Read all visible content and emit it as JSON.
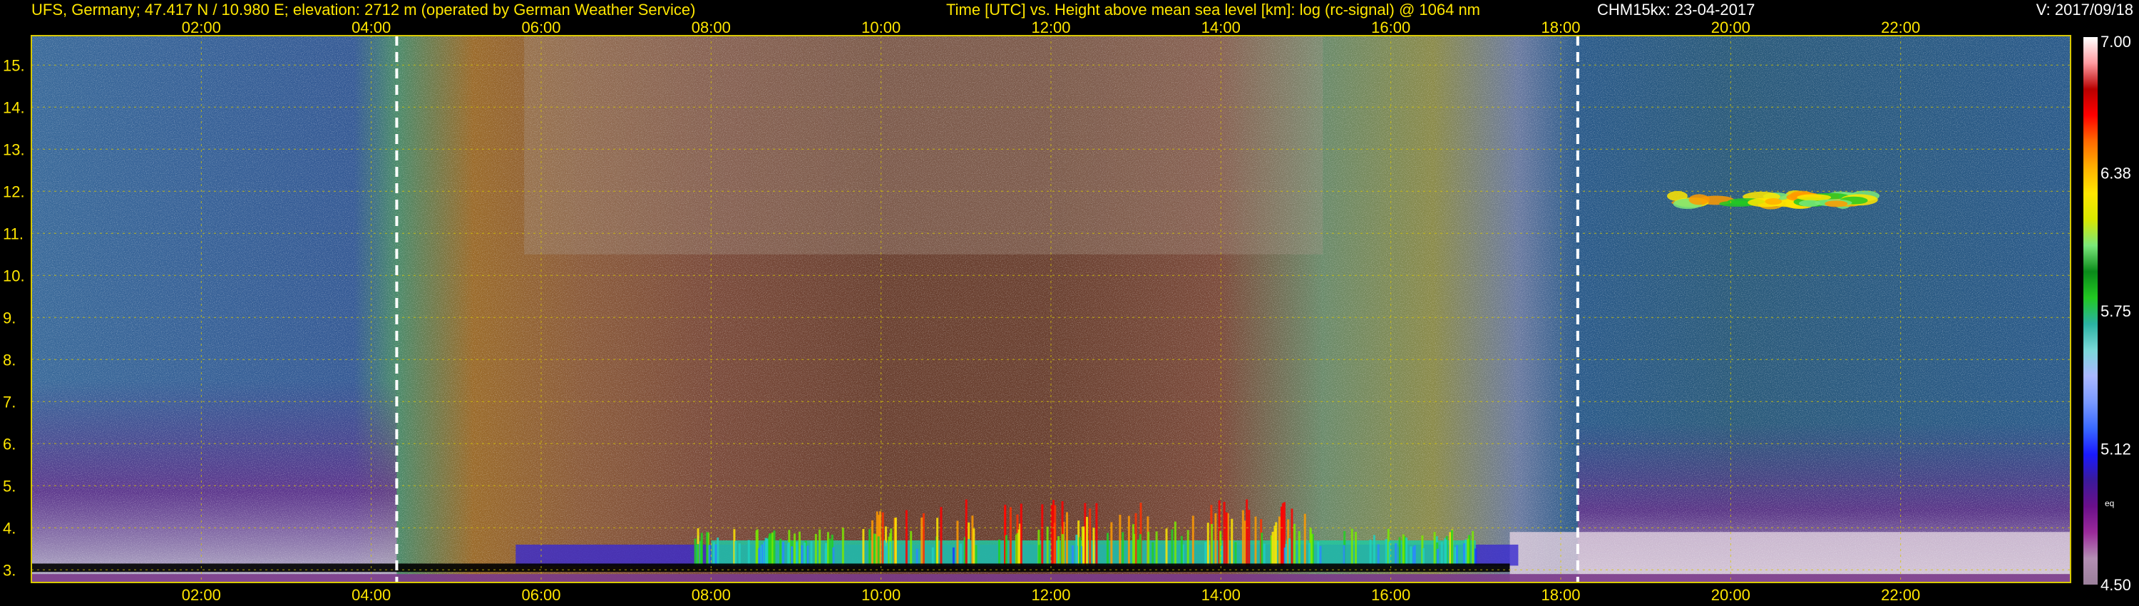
{
  "header": {
    "left": "UFS, Germany; 47.417 N / 10.980 E; elevation: 2712 m  (operated by German Weather Service)",
    "center": "Time [UTC] vs. Height above mean sea level [km]: log (rc-signal) @ 1064 nm",
    "instrument": "CHM15kx: 23-04-2017",
    "version": "V: 2017/09/18"
  },
  "chart_data": {
    "type": "heatmap",
    "xlabel": "Time [UTC]",
    "ylabel": "Height above mean sea level [km]",
    "x_range_hours": [
      0,
      24
    ],
    "y_range_km": [
      2.7,
      15.7
    ],
    "x_ticks": [
      {
        "hour": 2,
        "label": "02:00"
      },
      {
        "hour": 4,
        "label": "04:00"
      },
      {
        "hour": 6,
        "label": "06:00"
      },
      {
        "hour": 8,
        "label": "08:00"
      },
      {
        "hour": 10,
        "label": "10:00"
      },
      {
        "hour": 12,
        "label": "12:00"
      },
      {
        "hour": 14,
        "label": "14:00"
      },
      {
        "hour": 16,
        "label": "16:00"
      },
      {
        "hour": 18,
        "label": "18:00"
      },
      {
        "hour": 20,
        "label": "20:00"
      },
      {
        "hour": 22,
        "label": "22:00"
      }
    ],
    "y_ticks": [
      {
        "km": 3,
        "label": "3."
      },
      {
        "km": 4,
        "label": "4."
      },
      {
        "km": 5,
        "label": "5."
      },
      {
        "km": 6,
        "label": "6."
      },
      {
        "km": 7,
        "label": "7."
      },
      {
        "km": 8,
        "label": "8."
      },
      {
        "km": 9,
        "label": "9."
      },
      {
        "km": 10,
        "label": "10."
      },
      {
        "km": 11,
        "label": "11."
      },
      {
        "km": 12,
        "label": "12."
      },
      {
        "km": 13,
        "label": "13."
      },
      {
        "km": 14,
        "label": "14."
      },
      {
        "km": 15,
        "label": "15."
      }
    ],
    "markers_hours": [
      4.3,
      18.2
    ],
    "grid": true,
    "colorbar": {
      "min": 4.5,
      "max": 7.0,
      "ticks": [
        "7.00",
        "6.38",
        "5.75",
        "5.12",
        "4.50"
      ],
      "tick_values": [
        7.0,
        6.38,
        5.75,
        5.12,
        4.5
      ],
      "side_label": "eq",
      "colors": [
        "#9a7f9a",
        "#b38fb3",
        "#9a2a9a",
        "#6a0f8a",
        "#3a1a9a",
        "#1a1aff",
        "#3a6aff",
        "#7a9aff",
        "#aab8ff",
        "#7ad8d8",
        "#2ab2a2",
        "#22c822",
        "#0a8a1a",
        "#7ae87a",
        "#d8e800",
        "#ffe600",
        "#ffb000",
        "#ff6a00",
        "#ff0000",
        "#b80000",
        "#ff9aa0",
        "#ffffff"
      ]
    },
    "features": {
      "cloud_layer": {
        "start_hour": 19.3,
        "end_hour": 21.6,
        "height_km": 11.8
      }
    }
  }
}
